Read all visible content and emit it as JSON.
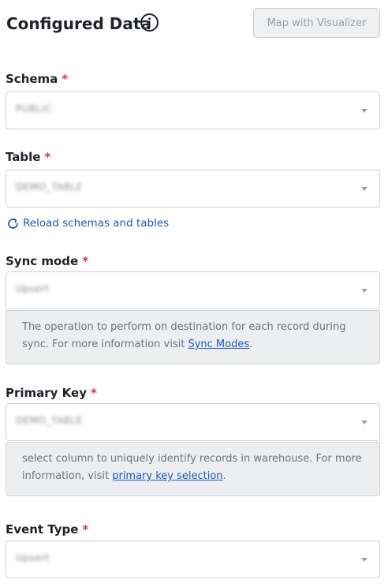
{
  "header": {
    "title": "Configured Data",
    "info_icon": "info-circle-icon",
    "map_button": "Map with Visualizer"
  },
  "fields": {
    "schema": {
      "label": "Schema",
      "required": "*",
      "value": "PUBLIC"
    },
    "table": {
      "label": "Table",
      "required": "*",
      "value": "DEMO_TABLE"
    },
    "sync_mode": {
      "label": "Sync mode",
      "required": "*",
      "value": "Upsert",
      "help_text": "The operation to perform on destination for each record during sync. For more information visit ",
      "help_link": "Sync Modes",
      "help_suffix": "."
    },
    "primary_key": {
      "label": "Primary Key",
      "required": "*",
      "value": "DEMO_TABLE",
      "help_text": "select column to uniquely identify records in warehouse. For more information, visit ",
      "help_link": "primary key selection",
      "help_suffix": "."
    },
    "event_type": {
      "label": "Event Type",
      "required": "*",
      "value": "Upsert"
    }
  },
  "reload": {
    "label": "Reload schemas and tables",
    "icon": "refresh-icon"
  },
  "colors": {
    "accent": "#1a56c7",
    "required": "#dc3545",
    "help_bg": "#eceeef"
  }
}
